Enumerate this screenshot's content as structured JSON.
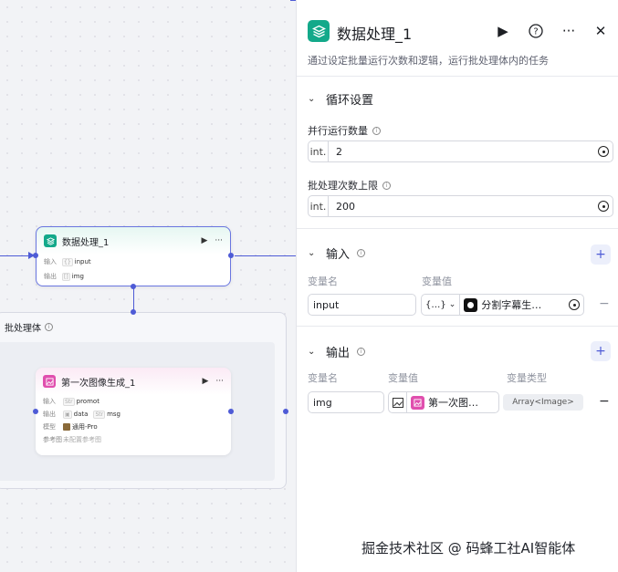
{
  "canvas": {
    "node_data": {
      "title": "数据处理_1",
      "input_key": "输入",
      "input_value": "input",
      "output_key": "输出",
      "output_value": "img"
    },
    "loop_body": {
      "title": "批处理体"
    },
    "node_image": {
      "title": "第一次图像生成_1",
      "input_key": "输入",
      "input_tag": "Str",
      "input_value": "promot",
      "output_key": "输出",
      "output_value_1": "data",
      "output_tag_2": "Str",
      "output_value_2": "msg",
      "model_key": "模型",
      "model_value": "通用-Pro",
      "ref_key": "参考图",
      "ref_value": "未配置参考图"
    }
  },
  "panel": {
    "title": "数据处理_1",
    "description": "通过设定批量运行次数和逻辑，运行批处理体内的任务",
    "loop_settings": {
      "section_title": "循环设置",
      "parallel_label": "并行运行数量",
      "parallel_type": "int.",
      "parallel_value": "2",
      "limit_label": "批处理次数上限",
      "limit_type": "int.",
      "limit_value": "200"
    },
    "inputs": {
      "section_title": "输入",
      "col_name": "变量名",
      "col_value": "变量值",
      "rows": [
        {
          "name": "input",
          "type_glyph": "{…}",
          "ref_label": "分割字幕生…"
        }
      ]
    },
    "outputs": {
      "section_title": "输出",
      "col_name": "变量名",
      "col_value": "变量值",
      "col_type": "变量类型",
      "rows": [
        {
          "name": "img",
          "ref_label": "第一次图…",
          "var_type": "Array<Image>"
        }
      ]
    }
  },
  "watermark": "掘金技术社区 @ 码蜂工社AI智能体",
  "colors": {
    "accent": "#4e5bd6",
    "node_teal": "#13a98a",
    "image_pink": "#e04fae"
  }
}
